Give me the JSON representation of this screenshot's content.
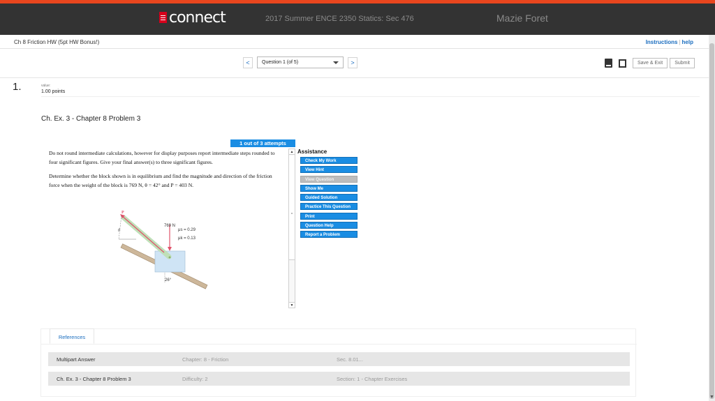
{
  "header": {
    "logo_text": "connect",
    "course": "2017 Summer ENCE 2350 Statics: Sec 476",
    "user": "Mazie Foret"
  },
  "subheader": {
    "title": "Ch 8 Friction HW (5pt HW Bonus!)",
    "instructions": "Instructions",
    "help": "help"
  },
  "question_nav": {
    "prev": "<",
    "selected": "Question 1 (of 5)",
    "next": ">"
  },
  "toolbar": {
    "save_exit": "Save & Exit",
    "submit": "Submit"
  },
  "question": {
    "number": "1.",
    "value_label": "value:",
    "points": "1.00 points",
    "title": "Ch. Ex. 3 - Chapter 8 Problem 3",
    "attempts": "1 out of 3 attempts",
    "para1": "Do not round intermediate calculations, however for display purposes report intermediate steps rounded to four significant figures. Give your final answer(s) to three significant figures.",
    "para2": "Determine whether the block shown is in equilibrium and find the magnitude and direction of the friction force when the weight of the block is 769 N, θ = 42° and P = 403 N."
  },
  "figure": {
    "label_p": "P",
    "label_theta": "θ",
    "label_weight": "769 N",
    "label_mus": "μs = 0.29",
    "label_muk": "μk = 0.13",
    "label_angle": "26°"
  },
  "assistance": {
    "title": "Assistance",
    "buttons": [
      {
        "label": "Check My Work",
        "enabled": true
      },
      {
        "label": "View Hint",
        "enabled": true
      },
      {
        "label": "View Question",
        "enabled": false
      },
      {
        "label": "Show Me",
        "enabled": true
      },
      {
        "label": "Guided Solution",
        "enabled": true
      },
      {
        "label": "Practice This Question",
        "enabled": true
      },
      {
        "label": "Print",
        "enabled": true
      },
      {
        "label": "Question Help",
        "enabled": true
      },
      {
        "label": "Report a Problem",
        "enabled": true
      }
    ]
  },
  "references": {
    "tab": "References",
    "rows": [
      {
        "type": "Multipart Answer",
        "chapter": "Chapter: 8 - Friction",
        "section": "Sec. 8.01..."
      },
      {
        "type": "Ch. Ex. 3 - Chapter 8 Problem 3",
        "chapter": "Difficulty: 2",
        "section": "Section: 1 - Chapter Exercises"
      }
    ]
  },
  "colors": {
    "accent_blue": "#1a8de3",
    "top_border": "#e8461e",
    "header_bg": "#333333"
  }
}
